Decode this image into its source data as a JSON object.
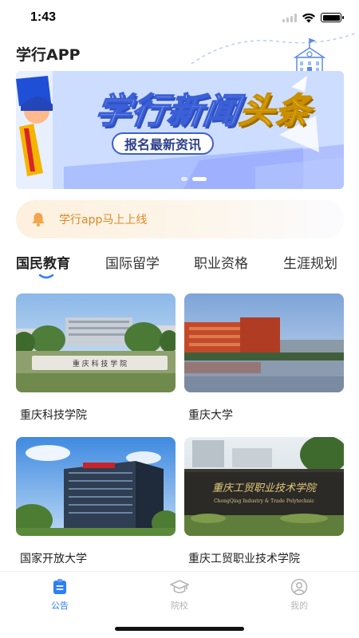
{
  "status": {
    "time": "1:43"
  },
  "app": {
    "title": "学行APP"
  },
  "banner": {
    "headline_part1": "学行新闻",
    "headline_part2": "头条",
    "subtitle": "报名最新资讯"
  },
  "notice": {
    "text": "学行app马上上线"
  },
  "tabs": [
    {
      "label": "国民教育",
      "active": true
    },
    {
      "label": "国际留学",
      "active": false
    },
    {
      "label": "职业资格",
      "active": false
    },
    {
      "label": "生涯规划",
      "active": false
    }
  ],
  "schools": [
    {
      "name": "重庆科技学院"
    },
    {
      "name": "重庆大学"
    },
    {
      "name": "国家开放大学"
    },
    {
      "name": "重庆工贸职业技术学院"
    }
  ],
  "bottom_nav": [
    {
      "label": "公告",
      "icon": "announcement-icon",
      "active": true
    },
    {
      "label": "院校",
      "icon": "graduation-cap-icon",
      "active": false
    },
    {
      "label": "我的",
      "icon": "profile-icon",
      "active": false
    }
  ],
  "colors": {
    "accent": "#2d7ef7",
    "notice_text": "#d98a27",
    "banner_blue": "#3a5fd6",
    "banner_yellow": "#ffd83b"
  }
}
